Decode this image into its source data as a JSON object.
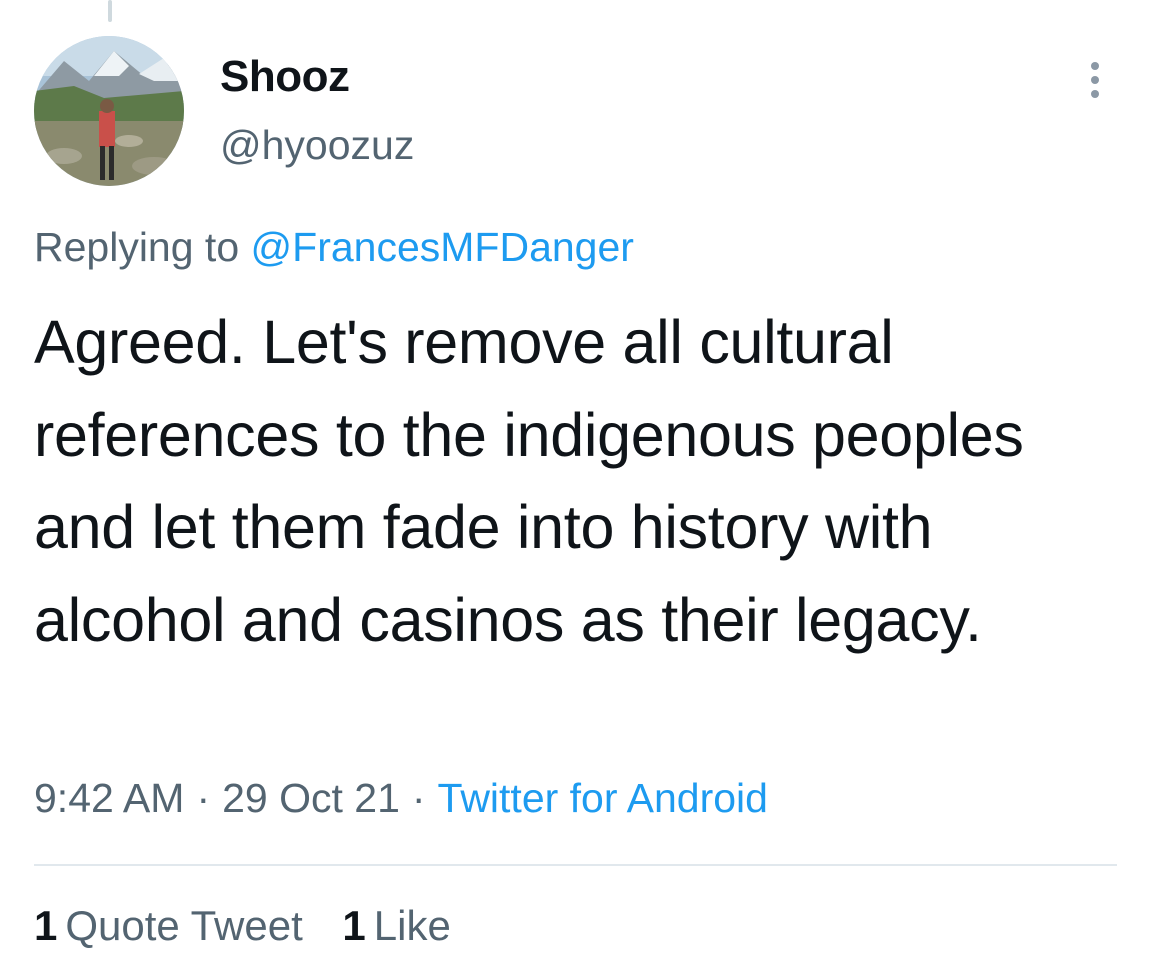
{
  "tweet": {
    "author": {
      "display_name": "Shooz",
      "handle": "@hyoozuz"
    },
    "reply": {
      "prefix": "Replying to",
      "target": "@FrancesMFDanger"
    },
    "text": "Agreed. Let's remove all cultural references to the indigenous peoples and let them fade into history with alcohol and casinos as their legacy.",
    "meta": {
      "time": "9:42 AM",
      "separator": "·",
      "date": "29 Oct 21",
      "source": "Twitter for Android"
    },
    "stats": {
      "quote_tweets_count": "1",
      "quote_tweets_label": "Quote Tweet",
      "likes_count": "1",
      "likes_label": "Like"
    }
  },
  "colors": {
    "text_primary": "#0f1419",
    "text_secondary": "#536471",
    "link": "#1d9bf0",
    "divider": "#e1e8ed"
  },
  "icons": {
    "more": "more-vertical-icon"
  }
}
